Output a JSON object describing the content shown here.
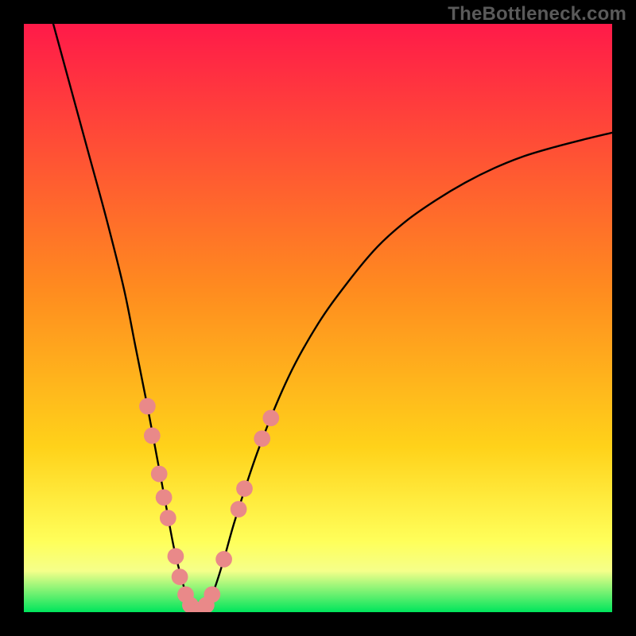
{
  "watermark": "TheBottleneck.com",
  "chart_data": {
    "type": "line",
    "title": "",
    "xlabel": "",
    "ylabel": "",
    "xlim": [
      0,
      100
    ],
    "ylim": [
      0,
      100
    ],
    "grid": false,
    "background_gradient": {
      "top_color": "#ff1a49",
      "mid_color": "#ffb300",
      "low_color": "#ffff5a",
      "bottom_color": "#00e55c"
    },
    "series": [
      {
        "name": "bottleneck-curve",
        "color": "#000000",
        "x": [
          5,
          8,
          11,
          14,
          17,
          19,
          21,
          22.5,
          24,
          25.5,
          27,
          28,
          29,
          30,
          32,
          34,
          36,
          40,
          45,
          50,
          55,
          60,
          65,
          70,
          75,
          80,
          85,
          90,
          95,
          100
        ],
        "y": [
          100,
          89,
          78,
          67,
          55,
          45,
          35,
          27,
          19,
          11,
          5,
          2,
          0.5,
          0.5,
          3,
          9,
          16,
          28,
          40,
          49,
          56,
          62,
          66.5,
          70,
          73,
          75.5,
          77.5,
          79,
          80.3,
          81.5
        ]
      }
    ],
    "markers": {
      "name": "highlighted-points",
      "color": "#e98989",
      "radius_pct": 1.4,
      "points": [
        {
          "x": 21.0,
          "y": 35.0
        },
        {
          "x": 21.8,
          "y": 30.0
        },
        {
          "x": 23.0,
          "y": 23.5
        },
        {
          "x": 23.8,
          "y": 19.5
        },
        {
          "x": 24.5,
          "y": 16.0
        },
        {
          "x": 25.8,
          "y": 9.5
        },
        {
          "x": 26.5,
          "y": 6.0
        },
        {
          "x": 27.5,
          "y": 3.0
        },
        {
          "x": 28.3,
          "y": 1.2
        },
        {
          "x": 29.0,
          "y": 0.4
        },
        {
          "x": 30.0,
          "y": 0.4
        },
        {
          "x": 31.0,
          "y": 1.2
        },
        {
          "x": 32.0,
          "y": 3.0
        },
        {
          "x": 34.0,
          "y": 9.0
        },
        {
          "x": 36.5,
          "y": 17.5
        },
        {
          "x": 37.5,
          "y": 21.0
        },
        {
          "x": 40.5,
          "y": 29.5
        },
        {
          "x": 42.0,
          "y": 33.0
        }
      ]
    }
  }
}
